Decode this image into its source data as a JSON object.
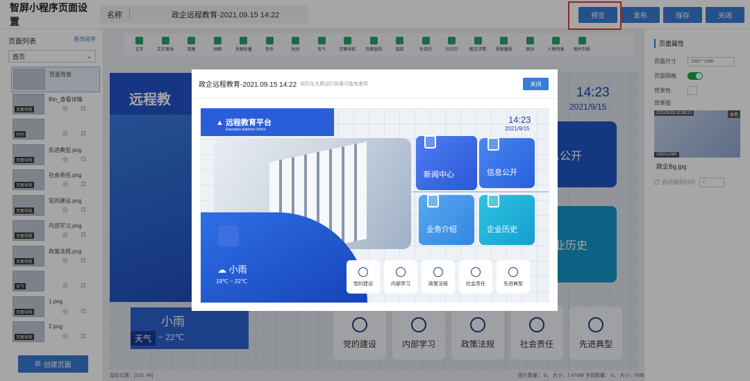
{
  "app": {
    "title": "智屏小程序页面设置",
    "name_label": "名称",
    "name_value": "政企远程教育-2021.09.15 14:22"
  },
  "topbar": {
    "preview": "预览",
    "publish": "发布",
    "save": "保存",
    "close": "关闭"
  },
  "left": {
    "header": "页面列表",
    "edit": "更改排序",
    "select": "首页",
    "create": "创建页面",
    "items": [
      {
        "name": "页面背景",
        "tag": ""
      },
      {
        "name": "Btn_查看详情",
        "tag": "页面导航"
      },
      {
        "name": "",
        "tag": "时间"
      },
      {
        "name": "先进典型.png",
        "tag": "页面导航"
      },
      {
        "name": "社会责任.png",
        "tag": "页面导航"
      },
      {
        "name": "党的建设.png",
        "tag": "页面导航"
      },
      {
        "name": "内部学习.png",
        "tag": "页面导航"
      },
      {
        "name": "政策法规.png",
        "tag": "页面导航"
      },
      {
        "name": "",
        "tag": "天气"
      },
      {
        "name": "1.png",
        "tag": "页面导航"
      },
      {
        "name": "2.png",
        "tag": "页面导航"
      }
    ]
  },
  "toolbar": {
    "tools": [
      "文字",
      "文字滚动",
      "单图",
      "动图",
      "多图轮播",
      "音乐",
      "时间",
      "天气",
      "页面导航",
      "页面返回",
      "链接",
      "住日历",
      "社日历",
      "图文详情",
      "视频播放",
      "滚动",
      "人物列表",
      "图片列表"
    ]
  },
  "right": {
    "title": "页面属性",
    "size_label": "页面尺寸",
    "size_value": "1920 * 1080",
    "grid_label": "页面网格",
    "bgcolor_label": "背景色",
    "bgimg_label": "背景图",
    "img_date": "2021/6/29 11:39:21",
    "img_badge": "本地",
    "img_size": "1920x1080",
    "file": "政企Bg.jpg",
    "auto_label": "自动换图时间",
    "auto_value": "0"
  },
  "canvas": {
    "clock": "14:23",
    "date": "2021/9/15",
    "tile1": "息公开",
    "tile2": "业历史",
    "weather": "小雨",
    "weather_tag": "天气",
    "weather_deg": "~ 22℃",
    "buttons": [
      "党的建设",
      "内部学习",
      "政策法规",
      "社会责任",
      "先进典型"
    ],
    "banner": "远程教"
  },
  "status": {
    "pos": "鼠标位置：[316, 49]",
    "stats": "图片数量： 8， 大小：2.47MB    字体数量： 0， 大小：0MB"
  },
  "modal": {
    "title": "政企远程教育-2021.09.15 14:22",
    "subtitle": "实际在大屏运行效果可能有差异",
    "close": "关闭",
    "logo": "远程教育平台",
    "logo_en": "Education platform Online",
    "clock": "14:23",
    "date": "2021/9/15",
    "tiles": [
      "新闻中心",
      "信息公开",
      "业务介绍",
      "企业历史"
    ],
    "weather": "小雨",
    "weather_deg": "19℃ ~ 22℃",
    "buttons": [
      "党的建设",
      "内部学习",
      "政策法规",
      "社会责任",
      "先进典型"
    ]
  }
}
